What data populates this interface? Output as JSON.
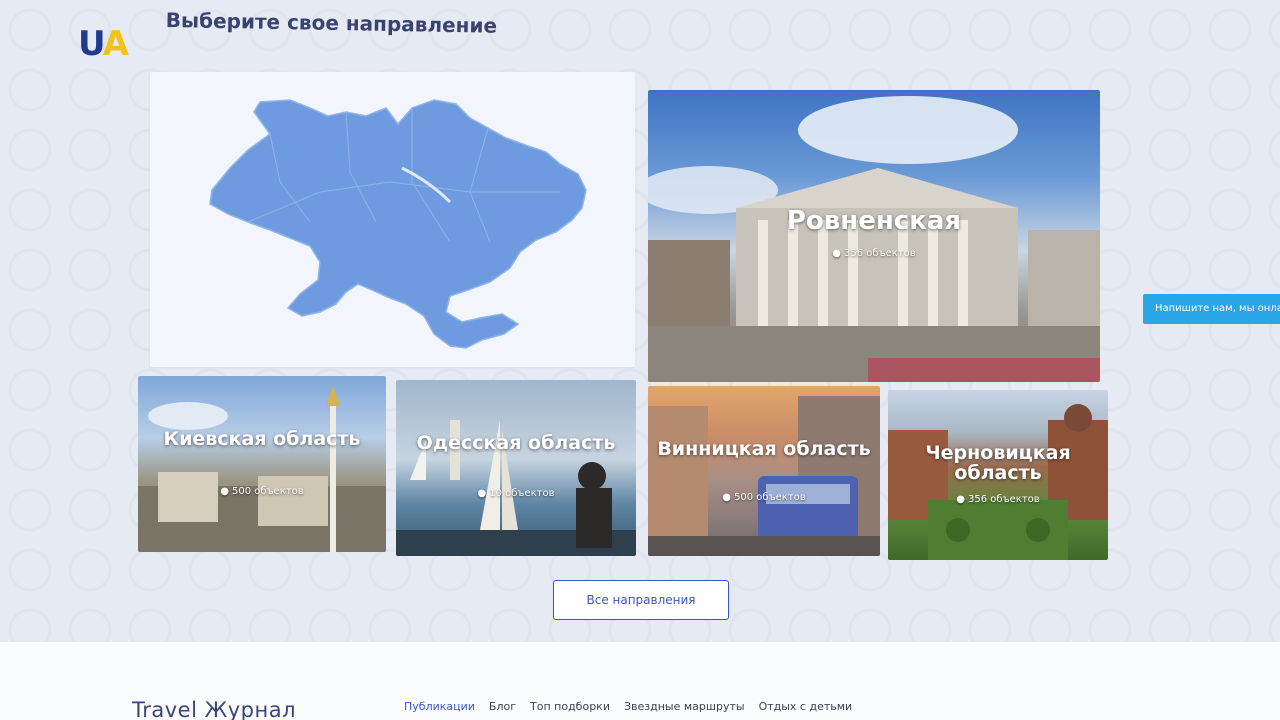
{
  "logo": {
    "u": "U",
    "a": "A"
  },
  "section": {
    "title": "Выберите свое направление"
  },
  "destinations": {
    "featured": {
      "name": "Ровненская",
      "count": "356 объектов"
    },
    "cards": [
      {
        "name": "Киевская область",
        "count": "500 объектов"
      },
      {
        "name": "Одесская область",
        "count": "10 объектов"
      },
      {
        "name": "Винницкая область",
        "count": "500 объектов"
      },
      {
        "name": "Черновицкая область",
        "count": "356 объектов"
      }
    ]
  },
  "all_button": {
    "label": "Все направления"
  },
  "chat": {
    "label": "Напишите нам, мы онлайн"
  },
  "journal": {
    "title": "Travel Журнал",
    "tabs": [
      "Публикации",
      "Блог",
      "Топ подборки",
      "Звездные маршруты",
      "Отдых с детьми"
    ],
    "active_tab": "Публикации"
  },
  "colors": {
    "accent": "#3a55c8",
    "map_fill": "#6e9be0",
    "chat": "#29a6e6",
    "logo_u": "#203a8f",
    "logo_a": "#f3c21a"
  }
}
